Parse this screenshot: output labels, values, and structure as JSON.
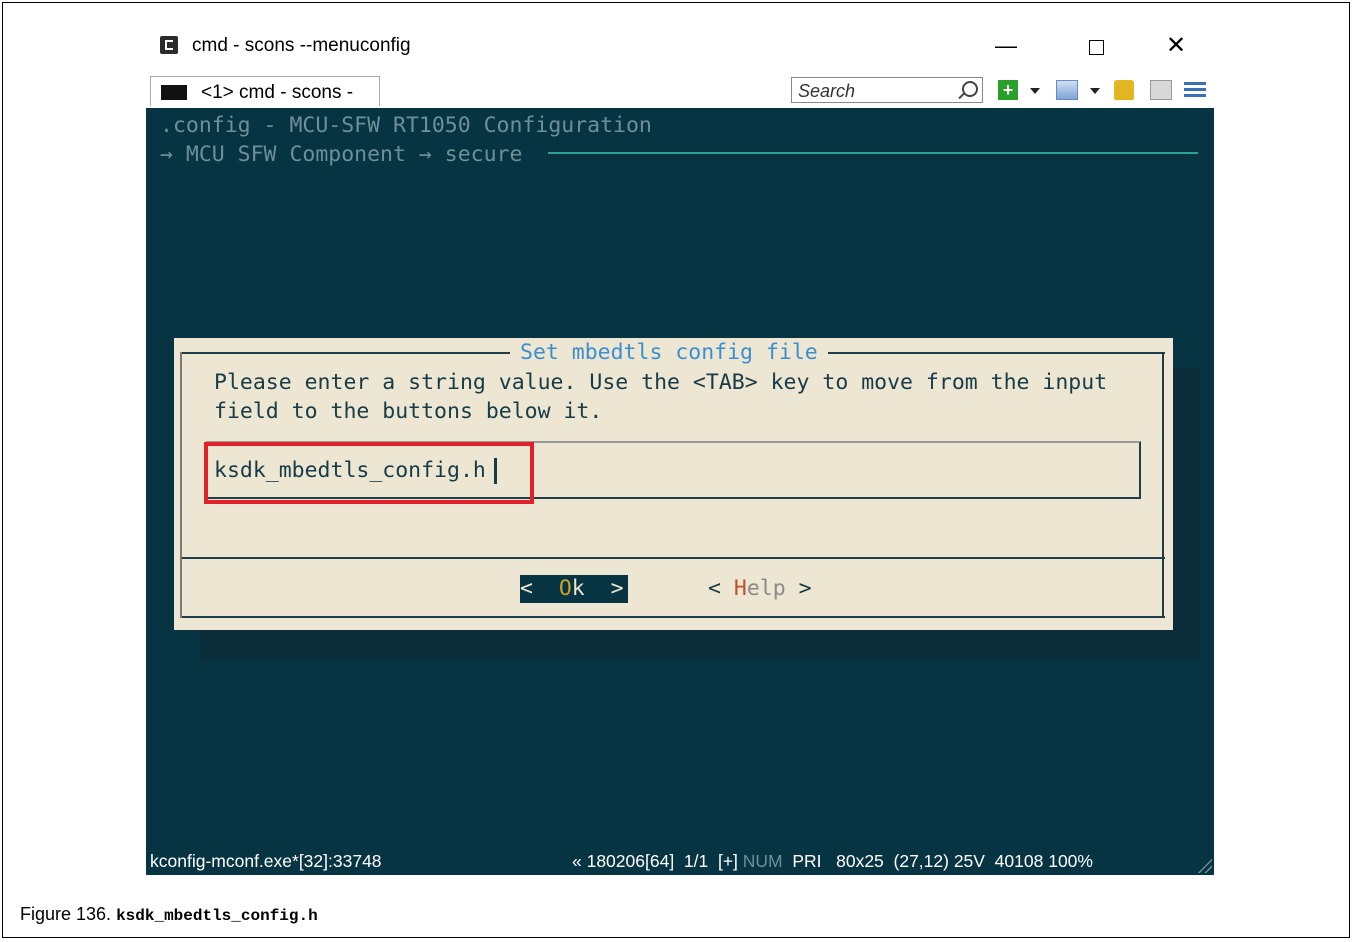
{
  "window": {
    "title": "cmd - scons  --menuconfig",
    "controls": {
      "minimize": "—",
      "maximize": "",
      "close": "✕"
    }
  },
  "toolbar": {
    "tab_label": "<1> cmd - scons  -",
    "search_placeholder": "Search",
    "icons": [
      "new-console-icon",
      "view-icon",
      "lock-icon",
      "panel-icon",
      "menu-icon"
    ],
    "plus_glyph": "+"
  },
  "terminal": {
    "line1": ".config - MCU-SFW RT1050 Configuration",
    "line2": "→ MCU SFW Component → secure"
  },
  "dialog": {
    "title": "Set mbedtls config file",
    "prompt_line1": "Please enter a string value. Use the <TAB> key to move from the input",
    "prompt_line2": "field to the buttons below it.",
    "input_value": "ksdk_mbedtls_config.h",
    "ok_open": "<  ",
    "ok_hot": "O",
    "ok_rest": "k  >",
    "help_open": "< ",
    "help_hot": "H",
    "help_rest": "elp",
    "help_close": " >"
  },
  "statusbar": {
    "left": "kconfig-mconf.exe*[32]:33748",
    "pos": "« 180206[64]  1/1  [+] ",
    "num": "NUM",
    "rest": "  PRI   80x25  (27,12) 25V  40108 100%"
  },
  "caption": {
    "figure": "Figure 136. ",
    "code": "ksdk_mbedtls_config.h"
  },
  "colors": {
    "terminal_bg": "#063443",
    "dialog_bg": "#ede6d3",
    "highlight": "#e0202a",
    "title_blue": "#3a8fd0"
  }
}
